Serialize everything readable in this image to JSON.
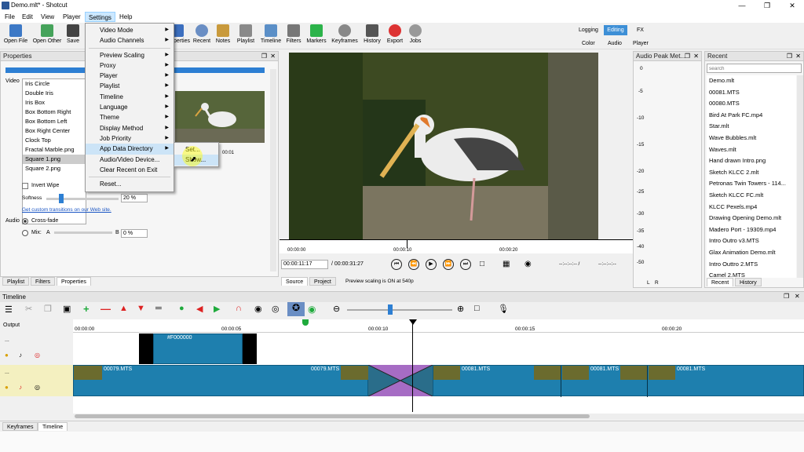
{
  "window": {
    "title": "Demo.mlt* - Shotcut"
  },
  "menubar": [
    "File",
    "Edit",
    "View",
    "Player",
    "Settings",
    "Help"
  ],
  "toolbar": {
    "items": [
      "Open File",
      "Open Other",
      "Save",
      "Properties",
      "Recent",
      "Notes",
      "Playlist",
      "Timeline",
      "Filters",
      "Markers",
      "Keyframes",
      "History",
      "Export",
      "Jobs"
    ],
    "layouts": {
      "logging": "Logging",
      "editing": "Editing",
      "fx": "FX",
      "color": "Color",
      "audio": "Audio",
      "player": "Player"
    }
  },
  "settings_menu": {
    "items": [
      "Video Mode",
      "Audio Channels",
      "Preview Scaling",
      "Proxy",
      "Player",
      "Playlist",
      "Timeline",
      "Language",
      "Theme",
      "Display Method",
      "Job Priority",
      "App Data Directory",
      "Audio/Video Device...",
      "Clear Recent on Exit",
      "Reset..."
    ],
    "submenu": [
      "Set...",
      "Show..."
    ]
  },
  "properties": {
    "title": "Properties",
    "video_label": "Video",
    "transitions": [
      "Iris Circle",
      "Double Iris",
      "Iris Box",
      "Box Bottom Right",
      "Box Bottom Left",
      "Box Right Center",
      "Clock Top",
      "Fractal Marble.png",
      "Square 1.png",
      "Square 2.png"
    ],
    "selected_transition": "Square 1.png",
    "invert_wipe": "Invert Wipe",
    "softness_label": "Softness",
    "softness_value": "20 %",
    "custom_link": "Get custom transitions on our Web site.",
    "audio_label": "Audio",
    "crossfade": "Cross-fade",
    "mix": "Mix:",
    "mix_a": "A",
    "mix_b": "B",
    "mix_value": "0 %",
    "preview_time": "00:01"
  },
  "left_tabs": [
    "Playlist",
    "Filters",
    "Properties"
  ],
  "player": {
    "ruler": [
      "00:00:00",
      "00:00:10",
      "00:00:20"
    ],
    "current_time": "00:00:11:17",
    "total_time": "/ 00:00:31:27",
    "in_point": "--:--:--:-- /",
    "out_point": "--:--:--:--",
    "source_tab": "Source",
    "project_tab": "Project",
    "status": "Preview scaling is ON at 540p"
  },
  "audio_meter": {
    "title": "Audio Peak Met...",
    "scale": [
      "0",
      "-5",
      "-10",
      "-15",
      "-20",
      "-25",
      "-30",
      "-35",
      "-40",
      "-50"
    ],
    "left": "L",
    "right": "R"
  },
  "recent": {
    "title": "Recent",
    "search": "search",
    "files": [
      "Demo.mlt",
      "00081.MTS",
      "00080.MTS",
      "Bird At Park FC.mp4",
      "Star.mlt",
      "Wave Bubbles.mlt",
      "Waves.mlt",
      "Hand drawn Intro.png",
      "Sketch KLCC 2.mlt",
      "Petronas Twin Towers - 114...",
      "Sketch KLCC FC.mlt",
      "KLCC Pexels.mp4",
      "Drawing Opening Demo.mlt",
      "Madero Port - 19309.mp4",
      "Intro Outro v3.MTS",
      "Glax Animation Demo.mlt",
      "Intro Outtro 2.MTS",
      "Camel 2.MTS"
    ],
    "tabs": [
      "Recent",
      "History"
    ]
  },
  "timeline": {
    "title": "Timeline",
    "output": "Output",
    "ruler": [
      "00:00:00",
      "00:00:05",
      "00:00:10",
      "00:00:15",
      "00:00:20"
    ],
    "track_dots": "...",
    "clip_color": "#F000000",
    "clips": [
      "00079.MTS",
      "00079.MTS",
      "00081.MTS",
      "00081.MTS",
      "00081.MTS"
    ]
  },
  "bottom_tabs": [
    "Keyframes",
    "Timeline"
  ],
  "colors": {
    "accent": "#1e7fae",
    "menu_highlight": "#cce4f7",
    "progress": "#2d7fd3"
  }
}
